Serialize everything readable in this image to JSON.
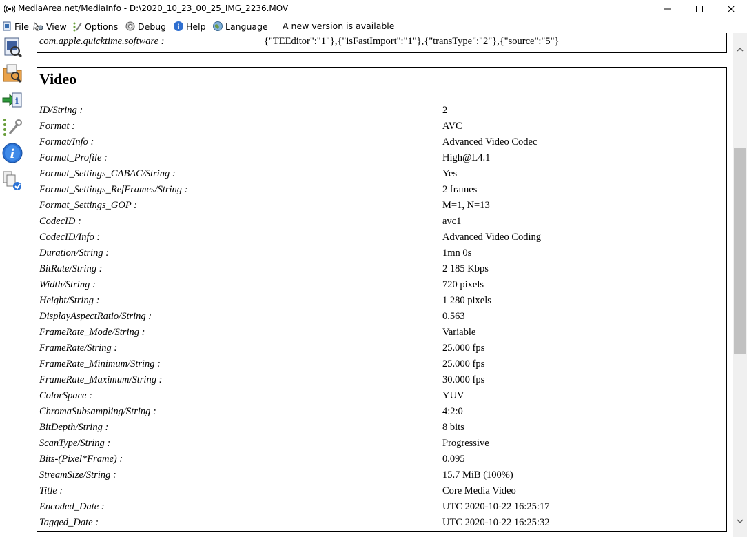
{
  "window": {
    "title": "MediaArea.net/MediaInfo - D:\\2020_10_23_00_25_IMG_2236.MOV"
  },
  "menu": {
    "file": "File",
    "view": "View",
    "options": "Options",
    "debug": "Debug",
    "help": "Help",
    "language": "Language",
    "update_notice": "A new version is available"
  },
  "toolbar_icons": [
    "open-file-icon",
    "open-folder-icon",
    "export-icon",
    "preferences-icon",
    "about-icon",
    "sheet-view-icon"
  ],
  "previous_section": {
    "key": "com.apple.quicktime.software :",
    "value": "{\"TEEditor\":\"1\"},{\"isFastImport\":\"1\"},{\"transType\":\"2\"},{\"source\":\"5\"}"
  },
  "video": {
    "heading": "Video",
    "rows": [
      {
        "key": "ID/String :",
        "value": "2"
      },
      {
        "key": "Format :",
        "value": "AVC"
      },
      {
        "key": "Format/Info :",
        "value": "Advanced Video Codec"
      },
      {
        "key": "Format_Profile :",
        "value": "High@L4.1"
      },
      {
        "key": "Format_Settings_CABAC/String :",
        "value": "Yes"
      },
      {
        "key": "Format_Settings_RefFrames/String :",
        "value": "2 frames"
      },
      {
        "key": "Format_Settings_GOP :",
        "value": "M=1, N=13"
      },
      {
        "key": "CodecID :",
        "value": "avc1"
      },
      {
        "key": "CodecID/Info :",
        "value": "Advanced Video Coding"
      },
      {
        "key": "Duration/String :",
        "value": "1mn 0s"
      },
      {
        "key": "BitRate/String :",
        "value": "2 185 Kbps"
      },
      {
        "key": "Width/String :",
        "value": "720 pixels"
      },
      {
        "key": "Height/String :",
        "value": "1 280 pixels"
      },
      {
        "key": "DisplayAspectRatio/String :",
        "value": "0.563"
      },
      {
        "key": "FrameRate_Mode/String :",
        "value": "Variable"
      },
      {
        "key": "FrameRate/String :",
        "value": "25.000 fps"
      },
      {
        "key": "FrameRate_Minimum/String :",
        "value": "25.000 fps"
      },
      {
        "key": "FrameRate_Maximum/String :",
        "value": "30.000 fps"
      },
      {
        "key": "ColorSpace :",
        "value": "YUV"
      },
      {
        "key": "ChromaSubsampling/String :",
        "value": "4:2:0"
      },
      {
        "key": "BitDepth/String :",
        "value": "8 bits"
      },
      {
        "key": "ScanType/String :",
        "value": "Progressive"
      },
      {
        "key": "Bits-(Pixel*Frame) :",
        "value": "0.095"
      },
      {
        "key": "StreamSize/String :",
        "value": "15.7 MiB (100%)"
      },
      {
        "key": "Title :",
        "value": "Core Media Video"
      },
      {
        "key": "Encoded_Date :",
        "value": "UTC 2020-10-22 16:25:17"
      },
      {
        "key": "Tagged_Date :",
        "value": "UTC 2020-10-22 16:25:32"
      }
    ]
  }
}
